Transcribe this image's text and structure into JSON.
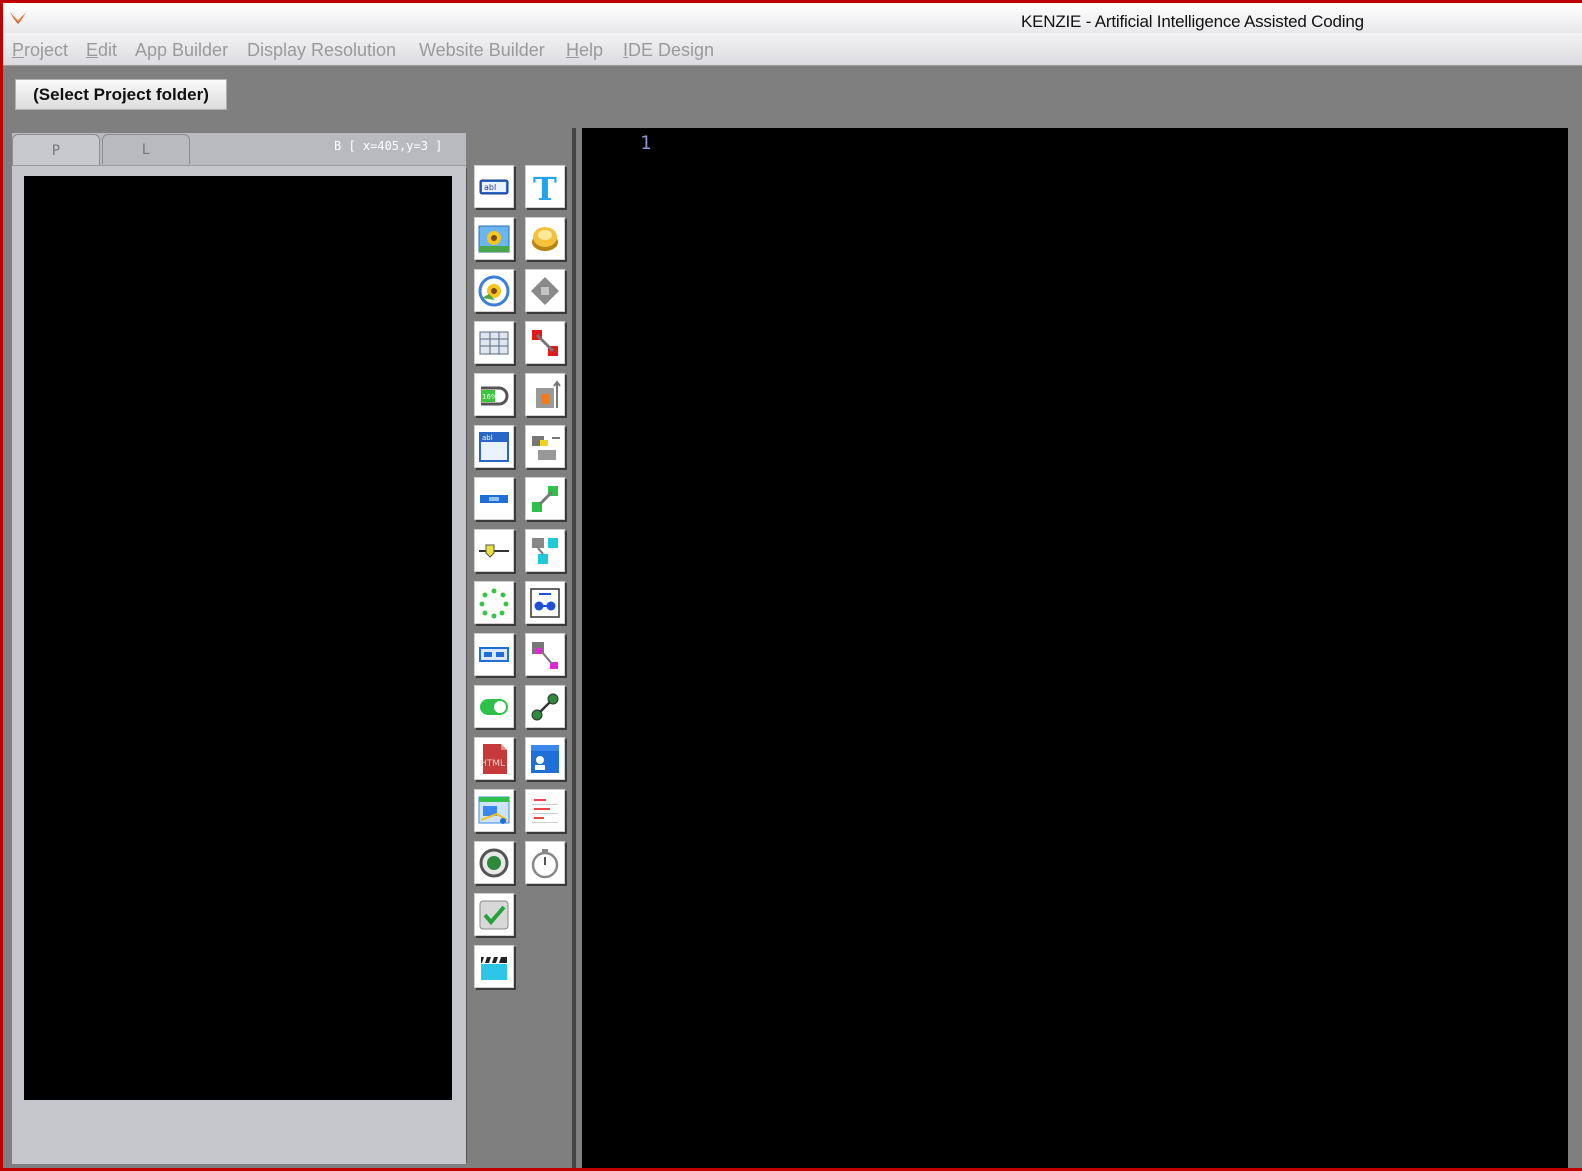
{
  "window": {
    "title": "KENZIE - Artificial Intelligence Assisted Coding",
    "logo_icon": "kenzie-wing-logo",
    "frame_color": "#c00000"
  },
  "menu": {
    "items": [
      {
        "label": "Project",
        "mnemonic": true
      },
      {
        "label": "Edit",
        "mnemonic": true
      },
      {
        "label": "App Builder",
        "mnemonic": false
      },
      {
        "label": "Display Resolution",
        "mnemonic": false
      },
      {
        "label": "Website Builder",
        "mnemonic": false
      },
      {
        "label": "Help",
        "mnemonic": true
      },
      {
        "label": "IDE Design",
        "mnemonic": true
      }
    ]
  },
  "toolbar": {
    "select_project_label": "(Select Project folder)"
  },
  "left_panel": {
    "tabs": [
      {
        "label": "P",
        "active": true
      },
      {
        "label": "L",
        "active": false
      }
    ],
    "coords_readout": "B [ x=405,y=3 ]"
  },
  "palette": {
    "tools": [
      {
        "icon": "textbox-icon"
      },
      {
        "icon": "text-label-icon"
      },
      {
        "icon": "image-icon"
      },
      {
        "icon": "button-icon"
      },
      {
        "icon": "image-slideshow-icon"
      },
      {
        "icon": "shape-icon"
      },
      {
        "icon": "table-icon"
      },
      {
        "icon": "connector-icon"
      },
      {
        "icon": "progress-bar-icon"
      },
      {
        "icon": "bring-to-front-icon"
      },
      {
        "icon": "textarea-icon"
      },
      {
        "icon": "align-icon"
      },
      {
        "icon": "input-field-icon"
      },
      {
        "icon": "resize-icon"
      },
      {
        "icon": "slider-icon"
      },
      {
        "icon": "hierarchy-icon"
      },
      {
        "icon": "spinner-icon"
      },
      {
        "icon": "distribute-icon"
      },
      {
        "icon": "number-stepper-icon"
      },
      {
        "icon": "anchor-icon"
      },
      {
        "icon": "toggle-switch-icon"
      },
      {
        "icon": "link-icon"
      },
      {
        "icon": "html-file-icon"
      },
      {
        "icon": "contact-card-icon"
      },
      {
        "icon": "map-icon"
      },
      {
        "icon": "list-menu-icon"
      },
      {
        "icon": "radio-button-icon"
      },
      {
        "icon": "timer-icon"
      },
      {
        "icon": "checkbox-icon"
      },
      null,
      {
        "icon": "video-clapper-icon"
      },
      null
    ]
  },
  "editor": {
    "line_numbers": [
      "1"
    ],
    "background": "#000000"
  }
}
